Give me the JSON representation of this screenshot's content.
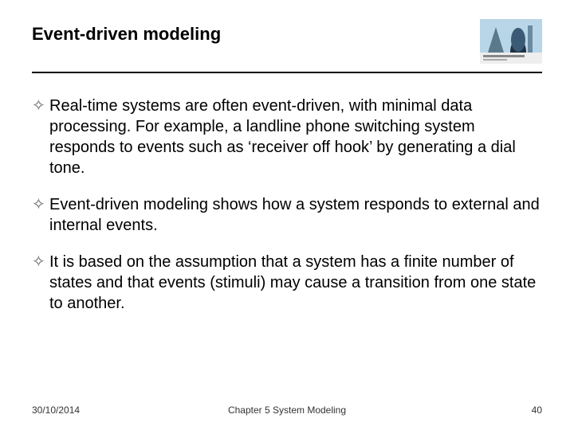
{
  "header": {
    "title": "Event-driven modeling",
    "logo_alt": "Software Engineering book cover thumbnail"
  },
  "bullets": [
    "Real-time systems are often event-driven, with minimal data processing. For example, a landline phone switching system responds to events such as ‘receiver off hook’ by generating a dial tone.",
    "Event-driven modeling shows how a system responds to external and internal events.",
    "It is based on the assumption that a system has a finite number of states and that events (stimuli) may cause a transition from one state to another."
  ],
  "footer": {
    "date": "30/10/2014",
    "chapter": "Chapter 5 System Modeling",
    "page": "40"
  }
}
